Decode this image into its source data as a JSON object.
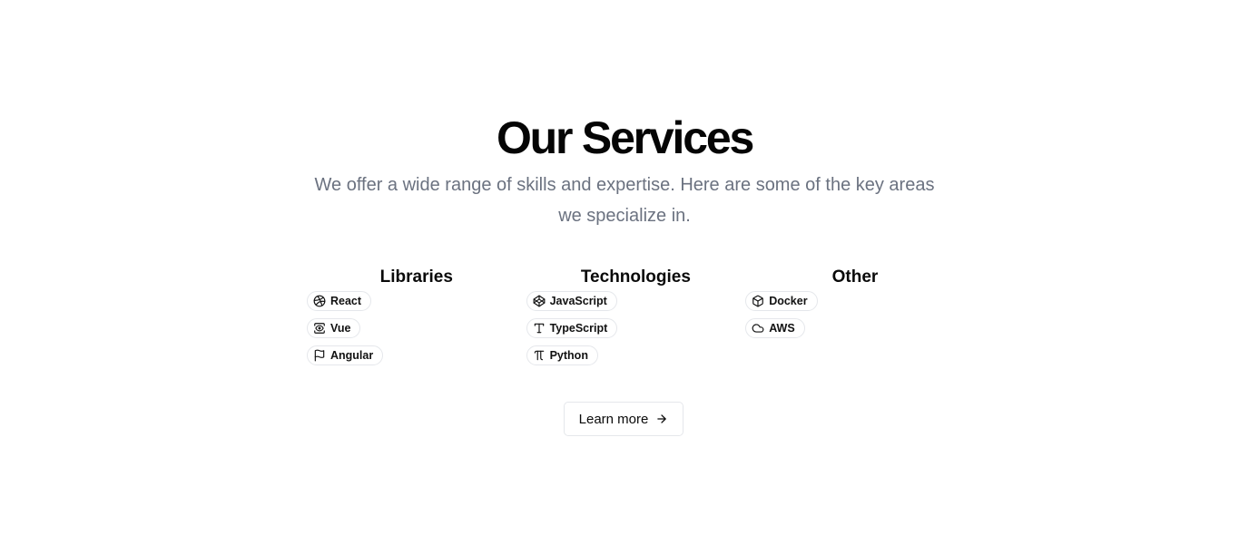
{
  "header": {
    "title": "Our Services",
    "subtitle": "We offer a wide range of skills and expertise. Here are some of the key areas we specialize in."
  },
  "categories": [
    {
      "heading": "Libraries",
      "items": [
        {
          "label": "React",
          "icon": "dribbble-icon"
        },
        {
          "label": "Vue",
          "icon": "view-icon"
        },
        {
          "label": "Angular",
          "icon": "flag-icon"
        }
      ]
    },
    {
      "heading": "Technologies",
      "items": [
        {
          "label": "JavaScript",
          "icon": "codepen-icon"
        },
        {
          "label": "TypeScript",
          "icon": "type-icon"
        },
        {
          "label": "Python",
          "icon": "pi-icon"
        }
      ]
    },
    {
      "heading": "Other",
      "items": [
        {
          "label": "Docker",
          "icon": "box-icon"
        },
        {
          "label": "AWS",
          "icon": "cloud-icon"
        }
      ]
    }
  ],
  "cta": {
    "label": "Learn more",
    "icon": "arrow-right-icon"
  },
  "colors": {
    "heading": "#050505",
    "subtitle": "#6b7280",
    "border": "#e5e7eb"
  }
}
